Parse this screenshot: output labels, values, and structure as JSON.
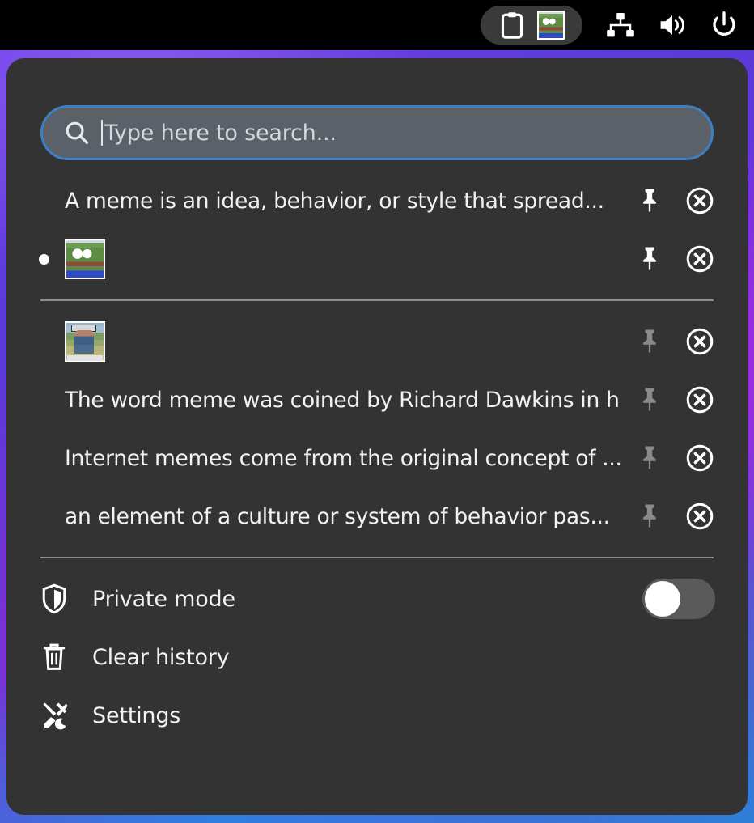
{
  "topbar": {
    "tray_group": [
      {
        "name": "clipboard-manager",
        "icon": "clipboard-icon",
        "label": "Clipboard"
      },
      {
        "name": "clipboard-image-preview",
        "icon": "frog-image-icon",
        "label": "Pepe image"
      }
    ],
    "system_icons": [
      {
        "name": "network",
        "icon": "network-icon",
        "label": "Network"
      },
      {
        "name": "volume",
        "icon": "volume-icon",
        "label": "Volume"
      },
      {
        "name": "power",
        "icon": "power-icon",
        "label": "Power"
      }
    ]
  },
  "search": {
    "placeholder": "Type here to search...",
    "value": "",
    "icon": "search-icon",
    "border_color": "#3b7fc4",
    "field_color": "#5b6169"
  },
  "pinned_section": {
    "items": [
      {
        "type": "text",
        "text": "A meme is an idea, behavior, or style that spread...",
        "selected": false,
        "pinned": true,
        "pin_icon": "pin-icon",
        "delete_icon": "remove-circle-icon"
      },
      {
        "type": "image",
        "text": "",
        "thumbnail": "pepe-frog-thumbnail",
        "selected": true,
        "pinned": true,
        "pin_icon": "pin-icon",
        "delete_icon": "remove-circle-icon"
      }
    ]
  },
  "history_section": {
    "items": [
      {
        "type": "image",
        "text": "",
        "thumbnail": "meme-photo-thumbnail",
        "selected": false,
        "pinned": false,
        "pin_icon": "pin-icon",
        "delete_icon": "remove-circle-icon"
      },
      {
        "type": "text",
        "text": "The word meme was coined by Richard Dawkins in hi...",
        "selected": false,
        "pinned": false,
        "pin_icon": "pin-icon",
        "delete_icon": "remove-circle-icon"
      },
      {
        "type": "text",
        "text": "Internet memes come from the original concept of ...",
        "selected": false,
        "pinned": false,
        "pin_icon": "pin-icon",
        "delete_icon": "remove-circle-icon"
      },
      {
        "type": "text",
        "text": "an element of a culture or system of behavior pas...",
        "selected": false,
        "pinned": false,
        "pin_icon": "pin-icon",
        "delete_icon": "remove-circle-icon"
      }
    ]
  },
  "menu": {
    "private_mode": {
      "label": "Private mode",
      "icon": "shield-icon",
      "enabled": false
    },
    "clear_history": {
      "label": "Clear history",
      "icon": "trash-icon"
    },
    "settings": {
      "label": "Settings",
      "icon": "tools-icon"
    }
  },
  "colors": {
    "panel_bg": "#333333",
    "text": "#f2f2f2",
    "accent": "#3b7fc4",
    "pin_active": "#ffffff",
    "pin_inactive": "#8a8a8a",
    "divider": "#8d8d8d"
  }
}
